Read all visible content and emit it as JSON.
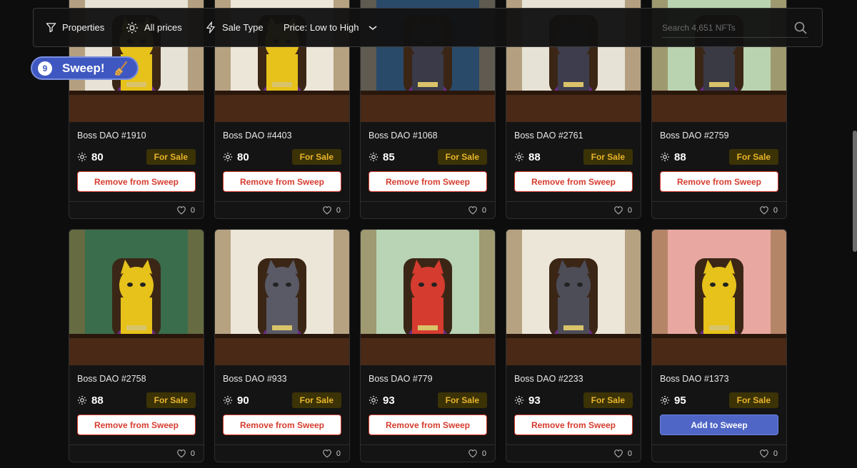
{
  "filters": {
    "properties": "Properties",
    "all_prices": "All prices",
    "sale_type": "Sale Type",
    "sort": "Price: Low to High",
    "search_placeholder": "Search 4,651 NFTs"
  },
  "sweep": {
    "count": "9",
    "label": "Sweep!"
  },
  "cards": [
    {
      "name": "Boss DAO #1910",
      "price": "80",
      "status": "For Sale",
      "action": "Remove from Sweep",
      "likes": "0",
      "bg": "#e7e2d6",
      "fur": "#e6c21a"
    },
    {
      "name": "Boss DAO #4403",
      "price": "80",
      "status": "For Sale",
      "action": "Remove from Sweep",
      "likes": "0",
      "bg": "#ece6d8",
      "fur": "#e6c21a"
    },
    {
      "name": "Boss DAO #1068",
      "price": "85",
      "status": "For Sale",
      "action": "Remove from Sweep",
      "likes": "0",
      "bg": "#2a4a6a",
      "fur": "#3a3a48"
    },
    {
      "name": "Boss DAO #2761",
      "price": "88",
      "status": "For Sale",
      "action": "Remove from Sweep",
      "likes": "0",
      "bg": "#e7e2d6",
      "fur": "#3d3d4e"
    },
    {
      "name": "Boss DAO #2759",
      "price": "88",
      "status": "For Sale",
      "action": "Remove from Sweep",
      "likes": "0",
      "bg": "#b9d3b0",
      "fur": "#3a3a44"
    },
    {
      "name": "Boss DAO #2758",
      "price": "88",
      "status": "For Sale",
      "action": "Remove from Sweep",
      "likes": "0",
      "bg": "#3a6d4c",
      "fur": "#e6c21a"
    },
    {
      "name": "Boss DAO #933",
      "price": "90",
      "status": "For Sale",
      "action": "Remove from Sweep",
      "likes": "0",
      "bg": "#ece6d8",
      "fur": "#5a5a66"
    },
    {
      "name": "Boss DAO #779",
      "price": "93",
      "status": "For Sale",
      "action": "Remove from Sweep",
      "likes": "0",
      "bg": "#b8d4b4",
      "fur": "#d63b2f"
    },
    {
      "name": "Boss DAO #2233",
      "price": "93",
      "status": "For Sale",
      "action": "Remove from Sweep",
      "likes": "0",
      "bg": "#ece6d8",
      "fur": "#4d4d58"
    },
    {
      "name": "Boss DAO #1373",
      "price": "95",
      "status": "For Sale",
      "action": "Add to Sweep",
      "likes": "0",
      "bg": "#e8a7a0",
      "fur": "#e6c21a"
    }
  ]
}
